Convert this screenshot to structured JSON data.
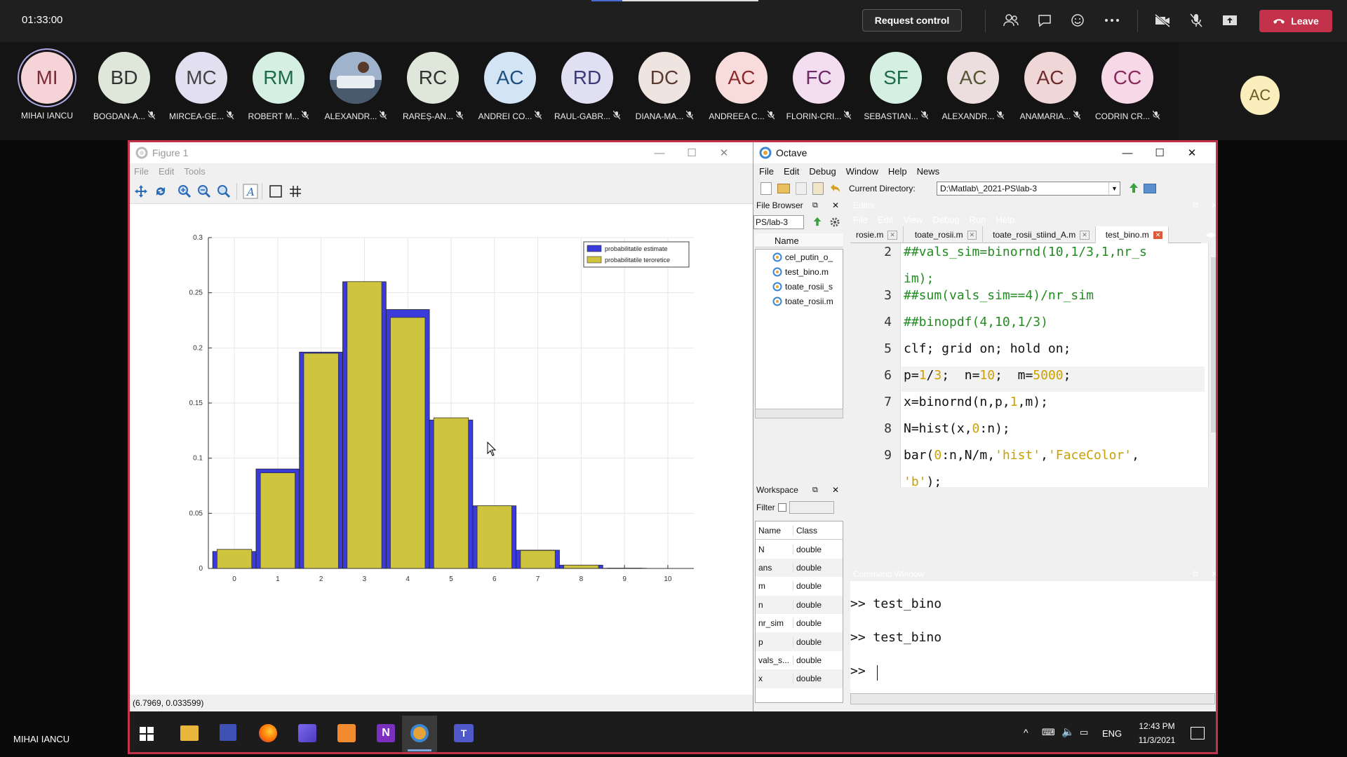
{
  "topbar": {
    "timer": "01:33:00",
    "request_control": "Request control",
    "leave": "Leave"
  },
  "participants": [
    {
      "initials": "MI",
      "name": "MIHAI IANCU",
      "bg": "#f6d3d6",
      "fg": "#7a2d38",
      "ring": true,
      "muted": false
    },
    {
      "initials": "BD",
      "name": "BOGDAN-A...",
      "bg": "#dfe6da",
      "fg": "#333",
      "muted": true
    },
    {
      "initials": "MC",
      "name": "MIRCEA-GE...",
      "bg": "#e2dff0",
      "fg": "#444",
      "muted": true
    },
    {
      "initials": "RM",
      "name": "ROBERT M...",
      "bg": "#d6efe3",
      "fg": "#1e6b48",
      "muted": true
    },
    {
      "initials": "",
      "name": "ALEXANDR...",
      "bg": "#7a8ea8",
      "fg": "#fff",
      "photo": true,
      "muted": true
    },
    {
      "initials": "RC",
      "name": "RAREȘ-AN...",
      "bg": "#dfe6da",
      "fg": "#333",
      "muted": true
    },
    {
      "initials": "AC",
      "name": "ANDREI CO...",
      "bg": "#d3e4f5",
      "fg": "#1d4f7f",
      "muted": true
    },
    {
      "initials": "RD",
      "name": "RAUL-GABR...",
      "bg": "#e1e0f3",
      "fg": "#3c3a7a",
      "muted": true
    },
    {
      "initials": "DC",
      "name": "DIANA-MA...",
      "bg": "#f0e4e0",
      "fg": "#5c3a31",
      "muted": true
    },
    {
      "initials": "AC",
      "name": "ANDREEA C...",
      "bg": "#f8dcdc",
      "fg": "#8a2b2b",
      "muted": true
    },
    {
      "initials": "FC",
      "name": "FLORIN-CRI...",
      "bg": "#f2def0",
      "fg": "#6e2a68",
      "muted": true
    },
    {
      "initials": "SF",
      "name": "SEBASTIAN...",
      "bg": "#d6efe3",
      "fg": "#1e6b48",
      "muted": true
    },
    {
      "initials": "AC",
      "name": "ALEXANDR...",
      "bg": "#ecdede",
      "fg": "#553",
      "muted": true
    },
    {
      "initials": "AC",
      "name": "ANAMARIA...",
      "bg": "#efd7d7",
      "fg": "#6f2c2c",
      "muted": true
    },
    {
      "initials": "CC",
      "name": "CODRIN CR...",
      "bg": "#f6d8e7",
      "fg": "#8a2b5c",
      "muted": true
    }
  ],
  "self": {
    "initials": "AC"
  },
  "presenter_label": "MIHAI IANCU",
  "figure": {
    "title": "Figure 1",
    "menu": [
      "File",
      "Edit",
      "Tools"
    ],
    "status": "(6.7969, 0.033599)"
  },
  "chart_data": {
    "type": "bar",
    "categories": [
      0,
      1,
      2,
      3,
      4,
      5,
      6,
      7,
      8,
      9,
      10
    ],
    "series": [
      {
        "name": "probabilitatile estimate",
        "color": "#3b3bdc",
        "values": [
          0.0154,
          0.0902,
          0.1962,
          0.26,
          0.2348,
          0.1346,
          0.0568,
          0.0166,
          0.003,
          0.0002,
          0.0
        ]
      },
      {
        "name": "probabilitatile teroretice",
        "color": "#cfc43d",
        "values": [
          0.0173,
          0.0867,
          0.1951,
          0.2601,
          0.2276,
          0.1366,
          0.0569,
          0.0163,
          0.003,
          0.0003,
          0.0
        ]
      }
    ],
    "yticks": [
      "0",
      "0.05",
      "0.1",
      "0.15",
      "0.2",
      "0.25",
      "0.3"
    ],
    "ylim": [
      0,
      0.3
    ],
    "xlim": [
      -0.6,
      10.6
    ],
    "grid": true,
    "legend_position": "top-right"
  },
  "octave": {
    "title": "Octave",
    "menu": [
      "File",
      "Edit",
      "Debug",
      "Window",
      "Help",
      "News"
    ],
    "curdir_label": "Current Directory:",
    "curdir": "D:\\Matlab\\_2021-PS\\lab-3",
    "file_browser": {
      "title": "File Browser",
      "path": "PS/lab-3",
      "col": "Name",
      "files": [
        "cel_putin_o_",
        "test_bino.m",
        "toate_rosii_s",
        "toate_rosii.m"
      ]
    },
    "workspace": {
      "title": "Workspace",
      "filter": "Filter",
      "cols": [
        "Name",
        "Class"
      ],
      "rows": [
        [
          "N",
          "double"
        ],
        [
          "ans",
          "double"
        ],
        [
          "m",
          "double"
        ],
        [
          "n",
          "double"
        ],
        [
          "nr_sim",
          "double"
        ],
        [
          "p",
          "double"
        ],
        [
          "vals_s...",
          "double"
        ],
        [
          "x",
          "double"
        ]
      ]
    },
    "editor": {
      "title": "Editor",
      "menu": [
        "File",
        "Edit",
        "View",
        "Debug",
        "Run",
        "Help"
      ],
      "tabs": [
        "rosie.m",
        "toate_rosii.m",
        "toate_rosii_stiind_A.m",
        "test_bino.m"
      ]
    },
    "command": {
      "title": "Command Window",
      "lines": [
        ">> test_bino",
        ">> test_bino",
        ">> "
      ]
    }
  },
  "taskbar": {
    "lang": "ENG",
    "time": "12:43 PM",
    "date": "11/3/2021"
  }
}
